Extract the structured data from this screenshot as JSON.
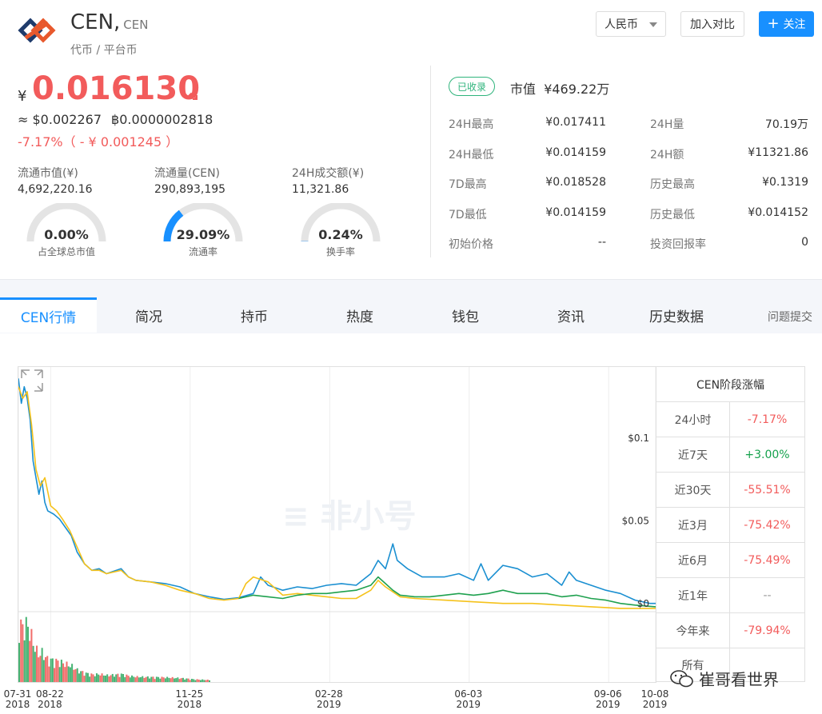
{
  "header": {
    "name": "CEN,",
    "symbol": "CEN",
    "category": "代币 / 平台币",
    "currency_selector": "人民币",
    "compare_label": "加入对比",
    "follow_label": "关注"
  },
  "price": {
    "currency_symbol": "¥",
    "value": "0.016130",
    "usd": "≈ $0.002267",
    "btc": "฿0.0000002818",
    "change": "-7.17%（ - ¥ 0.001245 ）"
  },
  "stats": [
    {
      "label": "流通市值(¥)",
      "value": "4,692,220.16",
      "gauge_value": "0.00%",
      "gauge_label": "占全球总市值",
      "fraction": 0.0
    },
    {
      "label": "流通量(CEN)",
      "value": "290,893,195",
      "gauge_value": "29.09%",
      "gauge_label": "流通率",
      "fraction": 0.2909
    },
    {
      "label": "24H成交额(¥)",
      "value": "11,321.86",
      "gauge_value": "0.24%",
      "gauge_label": "换手率",
      "fraction": 0.0024
    }
  ],
  "market": {
    "badge": "已收录",
    "cap_label": "市值",
    "cap_value": "¥469.22万",
    "left": [
      {
        "label": "24H最高",
        "value": "¥0.017411"
      },
      {
        "label": "24H最低",
        "value": "¥0.014159"
      },
      {
        "label": "7D最高",
        "value": "¥0.018528"
      },
      {
        "label": "7D最低",
        "value": "¥0.014159"
      },
      {
        "label": "初始价格",
        "value": "--"
      }
    ],
    "right": [
      {
        "label": "24H量",
        "value": "70.19万"
      },
      {
        "label": "24H额",
        "value": "¥11321.86"
      },
      {
        "label": "历史最高",
        "value": "¥0.1319"
      },
      {
        "label": "历史最低",
        "value": "¥0.014152"
      },
      {
        "label": "投资回报率",
        "value": "0"
      }
    ]
  },
  "tabs": [
    "CEN行情",
    "简况",
    "持币",
    "热度",
    "钱包",
    "资讯",
    "历史数据"
  ],
  "feedback": "问题提交",
  "performance": {
    "title": "CEN阶段涨幅",
    "rows": [
      {
        "label": "24小时",
        "value": "-7.17%",
        "tone": "neg"
      },
      {
        "label": "近7天",
        "value": "+3.00%",
        "tone": "pos"
      },
      {
        "label": "近30天",
        "value": "-55.51%",
        "tone": "neg"
      },
      {
        "label": "近3月",
        "value": "-75.42%",
        "tone": "neg"
      },
      {
        "label": "近6月",
        "value": "-75.49%",
        "tone": "neg"
      },
      {
        "label": "近1年",
        "value": "--",
        "tone": "neu"
      },
      {
        "label": "今年来",
        "value": "-79.94%",
        "tone": "neg"
      },
      {
        "label": "所有",
        "value": "",
        "tone": "link"
      }
    ]
  },
  "chart_watermark": "非小号",
  "wechat_watermark": "崔哥看世界",
  "chart_data": {
    "type": "line",
    "yticks": [
      "$0.1",
      "$0.05",
      "$0"
    ],
    "ylim": [
      0,
      0.145
    ],
    "xticks": [
      {
        "date": "07-31",
        "year": "2018",
        "t": 0
      },
      {
        "date": "08-22",
        "year": "2018",
        "t": 22
      },
      {
        "date": "11-25",
        "year": "2018",
        "t": 117
      },
      {
        "date": "02-28",
        "year": "2019",
        "t": 212
      },
      {
        "date": "06-03",
        "year": "2019",
        "t": 307
      },
      {
        "date": "09-06",
        "year": "2019",
        "t": 402
      },
      {
        "date": "10-08",
        "year": "2019",
        "t": 434
      }
    ],
    "series": [
      {
        "color": "#1a8fd1",
        "values": [
          [
            0,
            0.14
          ],
          [
            2,
            0.125
          ],
          [
            4,
            0.135
          ],
          [
            6,
            0.128
          ],
          [
            8,
            0.115
          ],
          [
            10,
            0.09
          ],
          [
            12,
            0.08
          ],
          [
            14,
            0.07
          ],
          [
            16,
            0.078
          ],
          [
            18,
            0.065
          ],
          [
            20,
            0.06
          ],
          [
            24,
            0.058
          ],
          [
            28,
            0.055
          ],
          [
            32,
            0.05
          ],
          [
            36,
            0.045
          ],
          [
            40,
            0.035
          ],
          [
            45,
            0.028
          ],
          [
            50,
            0.024
          ],
          [
            55,
            0.025
          ],
          [
            60,
            0.022
          ],
          [
            70,
            0.025
          ],
          [
            75,
            0.02
          ],
          [
            80,
            0.018
          ],
          [
            90,
            0.017
          ],
          [
            100,
            0.016
          ],
          [
            110,
            0.014
          ],
          [
            120,
            0.01
          ],
          [
            130,
            0.008
          ],
          [
            140,
            0.0065
          ],
          [
            150,
            0.0075
          ],
          [
            160,
            0.01
          ],
          [
            165,
            0.02
          ],
          [
            170,
            0.015
          ],
          [
            180,
            0.012
          ],
          [
            190,
            0.014
          ],
          [
            200,
            0.013
          ],
          [
            210,
            0.015
          ],
          [
            220,
            0.016
          ],
          [
            230,
            0.015
          ],
          [
            240,
            0.022
          ],
          [
            245,
            0.03
          ],
          [
            250,
            0.025
          ],
          [
            255,
            0.04
          ],
          [
            258,
            0.03
          ],
          [
            265,
            0.025
          ],
          [
            275,
            0.02
          ],
          [
            285,
            0.02
          ],
          [
            290,
            0.02
          ],
          [
            300,
            0.022
          ],
          [
            310,
            0.018
          ],
          [
            315,
            0.028
          ],
          [
            320,
            0.018
          ],
          [
            330,
            0.027
          ],
          [
            340,
            0.025
          ],
          [
            350,
            0.02
          ],
          [
            360,
            0.022
          ],
          [
            370,
            0.015
          ],
          [
            375,
            0.023
          ],
          [
            380,
            0.018
          ],
          [
            390,
            0.015
          ],
          [
            400,
            0.012
          ],
          [
            410,
            0.01
          ],
          [
            420,
            0.006
          ],
          [
            430,
            0.004
          ],
          [
            434,
            0.004
          ]
        ]
      },
      {
        "color": "#f5c21b",
        "values": [
          [
            0,
            0.135
          ],
          [
            3,
            0.128
          ],
          [
            6,
            0.132
          ],
          [
            9,
            0.112
          ],
          [
            12,
            0.085
          ],
          [
            15,
            0.075
          ],
          [
            18,
            0.08
          ],
          [
            22,
            0.063
          ],
          [
            26,
            0.06
          ],
          [
            30,
            0.055
          ],
          [
            35,
            0.048
          ],
          [
            40,
            0.038
          ],
          [
            45,
            0.028
          ],
          [
            50,
            0.024
          ],
          [
            55,
            0.024
          ],
          [
            60,
            0.022
          ],
          [
            70,
            0.024
          ],
          [
            75,
            0.02
          ],
          [
            80,
            0.018
          ],
          [
            90,
            0.017
          ],
          [
            100,
            0.015
          ],
          [
            110,
            0.012
          ],
          [
            120,
            0.01
          ],
          [
            130,
            0.007
          ],
          [
            140,
            0.006
          ],
          [
            150,
            0.007
          ],
          [
            155,
            0.016
          ],
          [
            160,
            0.02
          ],
          [
            170,
            0.017
          ],
          [
            180,
            0.009
          ],
          [
            190,
            0.01
          ],
          [
            200,
            0.009
          ],
          [
            210,
            0.008
          ],
          [
            220,
            0.007
          ],
          [
            230,
            0.007
          ],
          [
            240,
            0.012
          ],
          [
            245,
            0.018
          ],
          [
            250,
            0.014
          ],
          [
            260,
            0.008
          ],
          [
            270,
            0.007
          ],
          [
            290,
            0.006
          ],
          [
            310,
            0.005
          ],
          [
            330,
            0.004
          ],
          [
            350,
            0.004
          ],
          [
            370,
            0.003
          ],
          [
            390,
            0.002
          ],
          [
            410,
            0.001
          ],
          [
            434,
            0.001
          ]
        ]
      },
      {
        "color": "#1fa14f",
        "values": [
          [
            150,
            0.007
          ],
          [
            160,
            0.009
          ],
          [
            170,
            0.008
          ],
          [
            180,
            0.007
          ],
          [
            190,
            0.009
          ],
          [
            200,
            0.01
          ],
          [
            210,
            0.01
          ],
          [
            220,
            0.011
          ],
          [
            230,
            0.012
          ],
          [
            240,
            0.015
          ],
          [
            245,
            0.02
          ],
          [
            250,
            0.016
          ],
          [
            255,
            0.012
          ],
          [
            260,
            0.009
          ],
          [
            270,
            0.008
          ],
          [
            280,
            0.008
          ],
          [
            290,
            0.009
          ],
          [
            300,
            0.01
          ],
          [
            310,
            0.009
          ],
          [
            320,
            0.01
          ],
          [
            330,
            0.012
          ],
          [
            340,
            0.01
          ],
          [
            350,
            0.01
          ],
          [
            360,
            0.01
          ],
          [
            370,
            0.008
          ],
          [
            380,
            0.009
          ],
          [
            390,
            0.007
          ],
          [
            400,
            0.006
          ],
          [
            410,
            0.004
          ],
          [
            420,
            0.003
          ],
          [
            434,
            0.002
          ]
        ]
      }
    ]
  }
}
